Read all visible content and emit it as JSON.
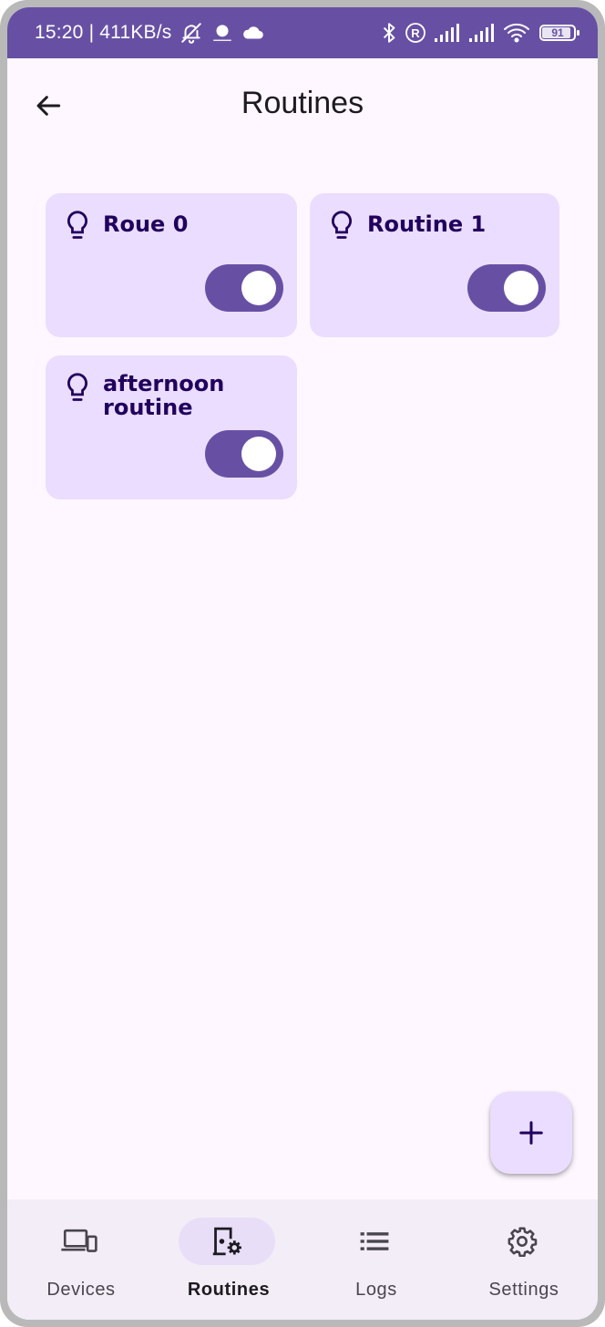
{
  "status_bar": {
    "time": "15:20 | 411KB/s",
    "battery": "91",
    "battery_level": 0.91,
    "icons": [
      "mute-bell-icon",
      "weather-icon",
      "cloud-icon",
      "bluetooth-icon",
      "roaming-icon",
      "signal-icon",
      "signal-icon",
      "wifi-icon",
      "battery-icon"
    ]
  },
  "header": {
    "title": "Routines",
    "back_icon": "arrow-left-icon"
  },
  "routines": [
    {
      "label": "Roue 0",
      "icon": "lightbulb-icon",
      "enabled": true
    },
    {
      "label": "Routine 1",
      "icon": "lightbulb-icon",
      "enabled": true
    },
    {
      "label": "afternoon routine",
      "icon": "lightbulb-icon",
      "enabled": true
    }
  ],
  "fab": {
    "icon": "plus-icon"
  },
  "bottom_nav": {
    "items": [
      {
        "label": "Devices",
        "icon": "devices-icon",
        "active": false
      },
      {
        "label": "Routines",
        "icon": "routines-icon",
        "active": true
      },
      {
        "label": "Logs",
        "icon": "list-icon",
        "active": false
      },
      {
        "label": "Settings",
        "icon": "gear-icon",
        "active": false
      }
    ]
  },
  "colors": {
    "primary": "#6750a4",
    "card_bg": "#eaddff",
    "surface": "#fef7ff",
    "nav_bg": "#f3edf7",
    "active_pill": "#e8def8"
  }
}
